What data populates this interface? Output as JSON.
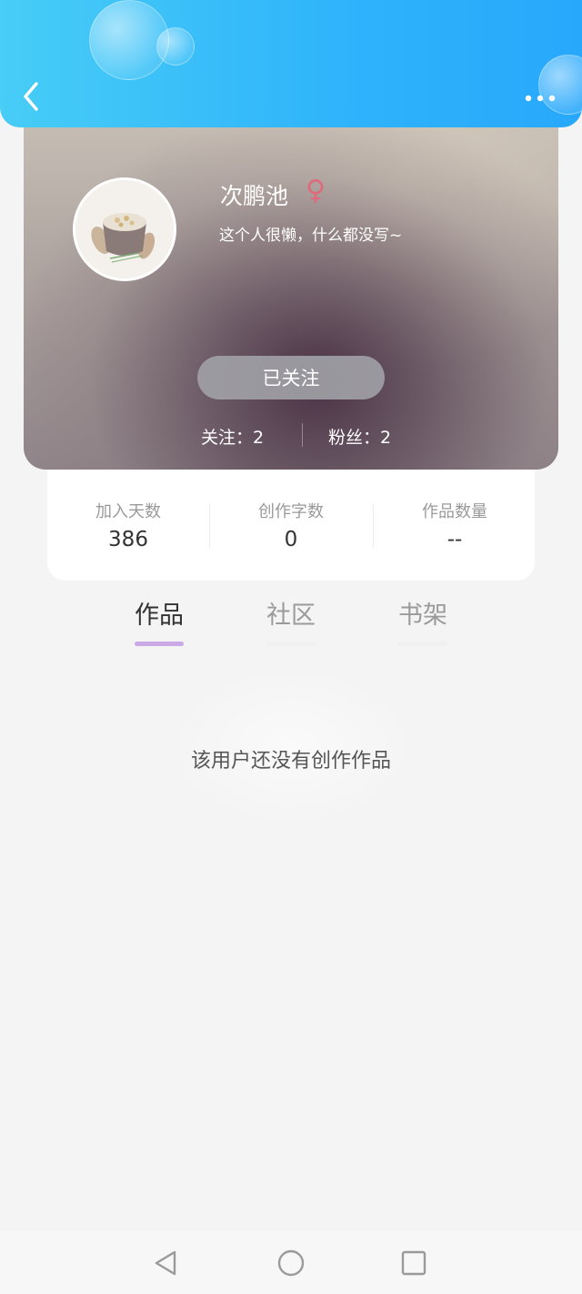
{
  "header": {
    "back_icon": "chevron-left-icon",
    "more_icon": "more-horizontal-icon",
    "accent_gradient": [
      "#47cdf6",
      "#28a8fb"
    ]
  },
  "profile": {
    "name": "次鹏池",
    "gender_icon": "female-symbol-icon",
    "gender_symbol": "♀",
    "gender_color": "#e06a7c",
    "bio": "这个人很懒，什么都没写~",
    "follow_button": "已关注",
    "following_text": "关注：2",
    "fans_text": "粉丝：2"
  },
  "stats": [
    {
      "label": "加入天数",
      "value": "386"
    },
    {
      "label": "创作字数",
      "value": "0"
    },
    {
      "label": "作品数量",
      "value": "--"
    }
  ],
  "tabs": [
    {
      "label": "作品",
      "active": true
    },
    {
      "label": "社区",
      "active": false
    },
    {
      "label": "书架",
      "active": false
    }
  ],
  "tab_colors": {
    "active_text": "#333333",
    "inactive_text": "#9a9a9a",
    "active_underline": "#c9a9e6"
  },
  "empty_state": {
    "text": "该用户还没有创作作品"
  },
  "system_nav": {
    "back_icon": "triangle-back-icon",
    "home_icon": "circle-home-icon",
    "recents_icon": "square-recents-icon"
  }
}
